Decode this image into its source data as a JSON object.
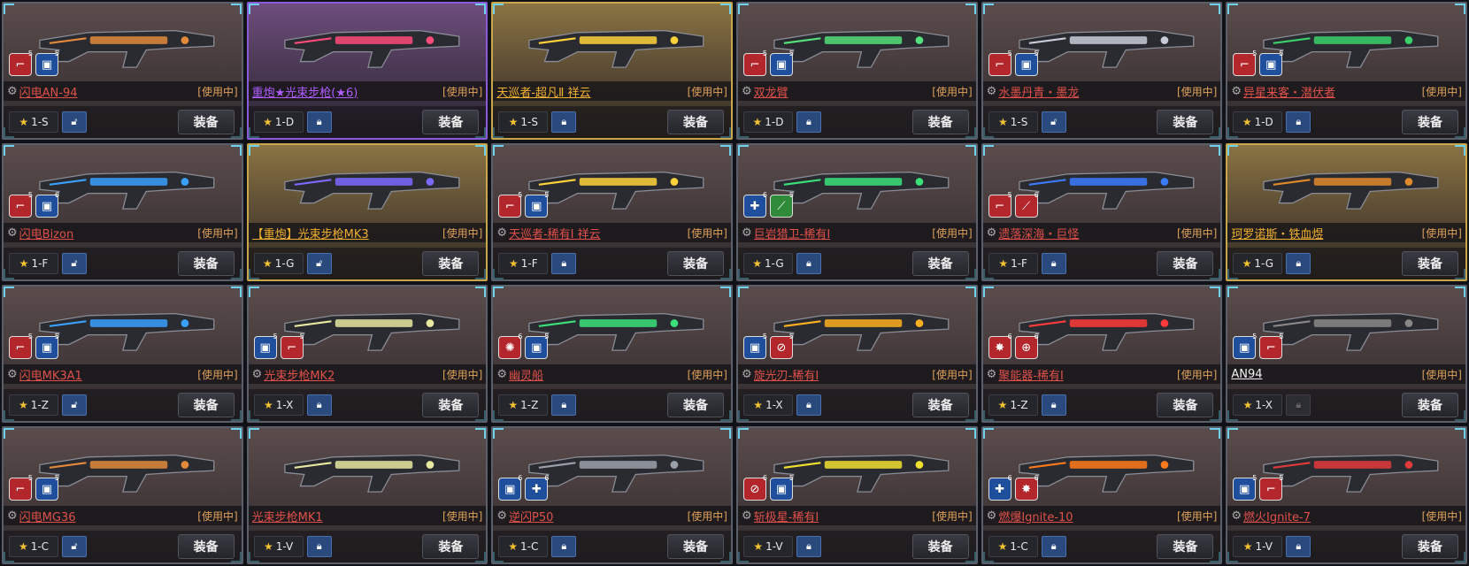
{
  "equip_label": "装备",
  "in_use_label": "[使用中]",
  "cards": [
    {
      "name": "闪电AN-94",
      "name_color": "#e0504a",
      "grade": "1-S",
      "theme": "default",
      "lock": "open",
      "accent": "#e28a3a",
      "mods": [
        {
          "c": "red",
          "g": "⌐",
          "lv": "5"
        },
        {
          "c": "blue",
          "g": "▣",
          "lv": "5"
        }
      ],
      "gear": true
    },
    {
      "name": "重炮★光束步枪(★6)",
      "name_color": "#b05cff",
      "grade": "1-D",
      "theme": "purple",
      "lock": "closed",
      "accent": "#ff4a7a",
      "mods": [],
      "gear": false
    },
    {
      "name": "天巡者-超凡Ⅱ 祥云",
      "name_color": "#f0b030",
      "grade": "1-S",
      "theme": "gold",
      "lock": "closed",
      "accent": "#ffd23a",
      "mods": [],
      "gear": false
    },
    {
      "name": "双龙臂",
      "name_color": "#e0504a",
      "grade": "1-D",
      "theme": "default",
      "lock": "closed",
      "accent": "#54e07a",
      "mods": [
        {
          "c": "red",
          "g": "⌐",
          "lv": "5"
        },
        {
          "c": "blue",
          "g": "▣",
          "lv": "5"
        }
      ],
      "gear": true
    },
    {
      "name": "水墨丹青・墨龙",
      "name_color": "#e0504a",
      "grade": "1-S",
      "theme": "default",
      "lock": "open",
      "accent": "#c8ccd8",
      "mods": [
        {
          "c": "red",
          "g": "⌐",
          "lv": "5"
        },
        {
          "c": "blue",
          "g": "▣",
          "lv": "5"
        }
      ],
      "gear": true
    },
    {
      "name": "异星来客・潜伏者",
      "name_color": "#e0504a",
      "grade": "1-D",
      "theme": "default",
      "lock": "closed",
      "accent": "#3ad06a",
      "mods": [
        {
          "c": "red",
          "g": "⌐",
          "lv": "5"
        },
        {
          "c": "blue",
          "g": "▣",
          "lv": "5"
        }
      ],
      "gear": true
    },
    {
      "name": "闪电Bizon",
      "name_color": "#e0504a",
      "grade": "1-F",
      "theme": "default",
      "lock": "open",
      "accent": "#3aa0ff",
      "mods": [
        {
          "c": "red",
          "g": "⌐",
          "lv": "5"
        },
        {
          "c": "blue",
          "g": "▣",
          "lv": "6"
        }
      ],
      "gear": true
    },
    {
      "name": "【重炮】光束步枪MK3",
      "name_color": "#f0b030",
      "grade": "1-G",
      "theme": "gold",
      "lock": "open",
      "accent": "#7a6aff",
      "mods": [],
      "gear": false
    },
    {
      "name": "天巡者-稀有Ⅰ 祥云",
      "name_color": "#e0504a",
      "grade": "1-F",
      "theme": "default",
      "lock": "closed",
      "accent": "#ffd23a",
      "mods": [
        {
          "c": "red",
          "g": "⌐",
          "lv": "5"
        },
        {
          "c": "blue",
          "g": "▣",
          "lv": "5"
        }
      ],
      "gear": true
    },
    {
      "name": "巨岩猎卫-稀有Ⅰ",
      "name_color": "#e0504a",
      "grade": "1-G",
      "theme": "default",
      "lock": "closed",
      "accent": "#3ae07a",
      "mods": [
        {
          "c": "blue",
          "g": "✚",
          "lv": "6"
        },
        {
          "c": "green",
          "g": "⟋",
          "lv": "5"
        }
      ],
      "gear": true
    },
    {
      "name": "遗落深海・巨怪",
      "name_color": "#e0504a",
      "grade": "1-F",
      "theme": "default",
      "lock": "closed",
      "accent": "#3a7aff",
      "mods": [
        {
          "c": "red",
          "g": "⌐",
          "lv": "5"
        },
        {
          "c": "red",
          "g": "⟋",
          "lv": "6"
        }
      ],
      "gear": true
    },
    {
      "name": "珂罗诺斯・铁血煜",
      "name_color": "#f0b030",
      "grade": "1-G",
      "theme": "gold",
      "lock": "closed",
      "accent": "#e08a2a",
      "mods": [],
      "gear": false
    },
    {
      "name": "闪电MK3A1",
      "name_color": "#e0504a",
      "grade": "1-Z",
      "theme": "default",
      "lock": "open",
      "accent": "#3aa0ff",
      "mods": [
        {
          "c": "red",
          "g": "⌐",
          "lv": "5"
        },
        {
          "c": "blue",
          "g": "▣",
          "lv": "5"
        }
      ],
      "gear": true
    },
    {
      "name": "光束步枪MK2",
      "name_color": "#e0504a",
      "grade": "1-X",
      "theme": "default",
      "lock": "closed",
      "accent": "#e8e8a0",
      "mods": [
        {
          "c": "blue",
          "g": "▣",
          "lv": "5"
        },
        {
          "c": "red",
          "g": "⌐",
          "lv": "5"
        }
      ],
      "gear": true
    },
    {
      "name": "幽灵船",
      "name_color": "#e0504a",
      "grade": "1-Z",
      "theme": "default",
      "lock": "closed",
      "accent": "#3ae07a",
      "mods": [
        {
          "c": "red",
          "g": "✺",
          "lv": "6"
        },
        {
          "c": "blue",
          "g": "▣",
          "lv": "5"
        }
      ],
      "gear": true
    },
    {
      "name": "旋光刃-稀有Ⅰ",
      "name_color": "#e0504a",
      "grade": "1-X",
      "theme": "default",
      "lock": "closed",
      "accent": "#ffb020",
      "mods": [
        {
          "c": "blue",
          "g": "▣",
          "lv": "5"
        },
        {
          "c": "red",
          "g": "⊘",
          "lv": "5"
        }
      ],
      "gear": true
    },
    {
      "name": "聚能器-稀有Ⅰ",
      "name_color": "#e0504a",
      "grade": "1-Z",
      "theme": "default",
      "lock": "closed",
      "accent": "#ff3a3a",
      "mods": [
        {
          "c": "red",
          "g": "✸",
          "lv": "6"
        },
        {
          "c": "red",
          "g": "⊕",
          "lv": "6"
        }
      ],
      "gear": true
    },
    {
      "name": "AN94",
      "name_color": "#f2f2f2",
      "grade": "1-X",
      "theme": "default",
      "lock": "grey",
      "accent": "#888888",
      "mods": [
        {
          "c": "blue",
          "g": "▣",
          "lv": "5"
        },
        {
          "c": "red",
          "g": "⌐",
          "lv": "5"
        }
      ],
      "gear": false
    },
    {
      "name": "闪电MG36",
      "name_color": "#e0504a",
      "grade": "1-C",
      "theme": "default",
      "lock": "open",
      "accent": "#e28a3a",
      "mods": [
        {
          "c": "red",
          "g": "⌐",
          "lv": "5"
        },
        {
          "c": "blue",
          "g": "▣",
          "lv": "5"
        }
      ],
      "gear": true
    },
    {
      "name": "光束步枪MK1",
      "name_color": "#e0504a",
      "grade": "1-V",
      "theme": "default",
      "lock": "closed",
      "accent": "#e8e8a0",
      "mods": [],
      "gear": false
    },
    {
      "name": "逆闪P50",
      "name_color": "#e0504a",
      "grade": "1-C",
      "theme": "default",
      "lock": "closed",
      "accent": "#9aa0aa",
      "mods": [
        {
          "c": "blue",
          "g": "▣",
          "lv": "6"
        },
        {
          "c": "blue",
          "g": "✚",
          "lv": "6"
        }
      ],
      "gear": true
    },
    {
      "name": "斩极星-稀有Ⅰ",
      "name_color": "#e0504a",
      "grade": "1-V",
      "theme": "default",
      "lock": "closed",
      "accent": "#f0e030",
      "mods": [
        {
          "c": "red",
          "g": "⊘",
          "lv": "6"
        },
        {
          "c": "blue",
          "g": "▣",
          "lv": "5"
        }
      ],
      "gear": true
    },
    {
      "name": "燃爆Ignite-10",
      "name_color": "#e0504a",
      "grade": "1-C",
      "theme": "default",
      "lock": "closed",
      "accent": "#ff7a1a",
      "mods": [
        {
          "c": "blue",
          "g": "✚",
          "lv": "6"
        },
        {
          "c": "red",
          "g": "✸",
          "lv": "6"
        }
      ],
      "gear": true
    },
    {
      "name": "燃火Ignite-7",
      "name_color": "#e0504a",
      "grade": "1-V",
      "theme": "default",
      "lock": "closed",
      "accent": "#e03a3a",
      "mods": [
        {
          "c": "blue",
          "g": "▣",
          "lv": "5"
        },
        {
          "c": "red",
          "g": "⌐",
          "lv": "5"
        }
      ],
      "gear": true
    }
  ]
}
